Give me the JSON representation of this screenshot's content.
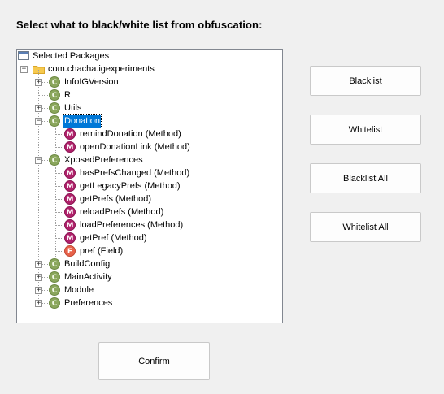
{
  "title": "Select what to black/white list from obfuscation:",
  "tree": {
    "root_label": "Selected Packages",
    "package_label": "com.chacha.igexperiments",
    "nodes": [
      {
        "label": "InfoIGVersion",
        "kind": "C"
      },
      {
        "label": "R",
        "kind": "C"
      },
      {
        "label": "Utils",
        "kind": "C"
      },
      {
        "label": "Donation",
        "kind": "C"
      },
      {
        "label": "remindDonation (Method)",
        "kind": "M"
      },
      {
        "label": "openDonationLink (Method)",
        "kind": "M"
      },
      {
        "label": "XposedPreferences",
        "kind": "C"
      },
      {
        "label": "hasPrefsChanged (Method)",
        "kind": "M"
      },
      {
        "label": "getLegacyPrefs (Method)",
        "kind": "M"
      },
      {
        "label": "getPrefs (Method)",
        "kind": "M"
      },
      {
        "label": "reloadPrefs (Method)",
        "kind": "M"
      },
      {
        "label": "loadPreferences (Method)",
        "kind": "M"
      },
      {
        "label": "getPref (Method)",
        "kind": "M"
      },
      {
        "label": "pref (Field)",
        "kind": "F"
      },
      {
        "label": "BuildConfig",
        "kind": "C"
      },
      {
        "label": "MainActivity",
        "kind": "C"
      },
      {
        "label": "Module",
        "kind": "C"
      },
      {
        "label": "Preferences",
        "kind": "C"
      }
    ]
  },
  "buttons": {
    "blacklist": "Blacklist",
    "whitelist": "Whitelist",
    "blacklist_all": "Blacklist All",
    "whitelist_all": "Whitelist All",
    "confirm": "Confirm"
  }
}
